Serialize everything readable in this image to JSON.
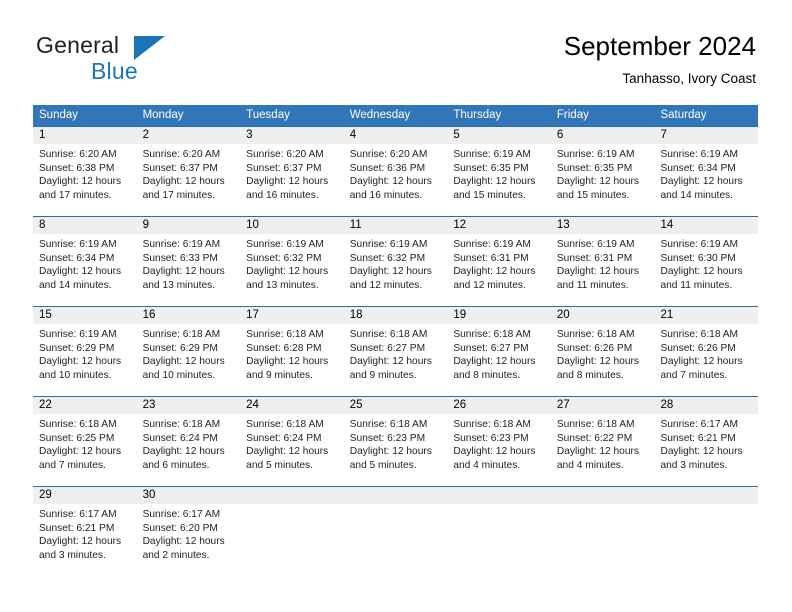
{
  "brand": {
    "name_part1": "General",
    "name_part2": "Blue",
    "logo_icon": "triangle-icon"
  },
  "header": {
    "title": "September 2024",
    "location": "Tanhasso, Ivory Coast"
  },
  "colors": {
    "header_blue": "#3176b9",
    "separator_blue": "#2b6cab",
    "date_band_gray": "#efefef",
    "brand_blue": "#1b75bb",
    "text": "#231f20"
  },
  "weekdays": [
    "Sunday",
    "Monday",
    "Tuesday",
    "Wednesday",
    "Thursday",
    "Friday",
    "Saturday"
  ],
  "weeks": [
    {
      "days": [
        {
          "date": "1",
          "sunrise": "Sunrise: 6:20 AM",
          "sunset": "Sunset: 6:38 PM",
          "daylight1": "Daylight: 12 hours",
          "daylight2": "and 17 minutes."
        },
        {
          "date": "2",
          "sunrise": "Sunrise: 6:20 AM",
          "sunset": "Sunset: 6:37 PM",
          "daylight1": "Daylight: 12 hours",
          "daylight2": "and 17 minutes."
        },
        {
          "date": "3",
          "sunrise": "Sunrise: 6:20 AM",
          "sunset": "Sunset: 6:37 PM",
          "daylight1": "Daylight: 12 hours",
          "daylight2": "and 16 minutes."
        },
        {
          "date": "4",
          "sunrise": "Sunrise: 6:20 AM",
          "sunset": "Sunset: 6:36 PM",
          "daylight1": "Daylight: 12 hours",
          "daylight2": "and 16 minutes."
        },
        {
          "date": "5",
          "sunrise": "Sunrise: 6:19 AM",
          "sunset": "Sunset: 6:35 PM",
          "daylight1": "Daylight: 12 hours",
          "daylight2": "and 15 minutes."
        },
        {
          "date": "6",
          "sunrise": "Sunrise: 6:19 AM",
          "sunset": "Sunset: 6:35 PM",
          "daylight1": "Daylight: 12 hours",
          "daylight2": "and 15 minutes."
        },
        {
          "date": "7",
          "sunrise": "Sunrise: 6:19 AM",
          "sunset": "Sunset: 6:34 PM",
          "daylight1": "Daylight: 12 hours",
          "daylight2": "and 14 minutes."
        }
      ]
    },
    {
      "days": [
        {
          "date": "8",
          "sunrise": "Sunrise: 6:19 AM",
          "sunset": "Sunset: 6:34 PM",
          "daylight1": "Daylight: 12 hours",
          "daylight2": "and 14 minutes."
        },
        {
          "date": "9",
          "sunrise": "Sunrise: 6:19 AM",
          "sunset": "Sunset: 6:33 PM",
          "daylight1": "Daylight: 12 hours",
          "daylight2": "and 13 minutes."
        },
        {
          "date": "10",
          "sunrise": "Sunrise: 6:19 AM",
          "sunset": "Sunset: 6:32 PM",
          "daylight1": "Daylight: 12 hours",
          "daylight2": "and 13 minutes."
        },
        {
          "date": "11",
          "sunrise": "Sunrise: 6:19 AM",
          "sunset": "Sunset: 6:32 PM",
          "daylight1": "Daylight: 12 hours",
          "daylight2": "and 12 minutes."
        },
        {
          "date": "12",
          "sunrise": "Sunrise: 6:19 AM",
          "sunset": "Sunset: 6:31 PM",
          "daylight1": "Daylight: 12 hours",
          "daylight2": "and 12 minutes."
        },
        {
          "date": "13",
          "sunrise": "Sunrise: 6:19 AM",
          "sunset": "Sunset: 6:31 PM",
          "daylight1": "Daylight: 12 hours",
          "daylight2": "and 11 minutes."
        },
        {
          "date": "14",
          "sunrise": "Sunrise: 6:19 AM",
          "sunset": "Sunset: 6:30 PM",
          "daylight1": "Daylight: 12 hours",
          "daylight2": "and 11 minutes."
        }
      ]
    },
    {
      "days": [
        {
          "date": "15",
          "sunrise": "Sunrise: 6:19 AM",
          "sunset": "Sunset: 6:29 PM",
          "daylight1": "Daylight: 12 hours",
          "daylight2": "and 10 minutes."
        },
        {
          "date": "16",
          "sunrise": "Sunrise: 6:18 AM",
          "sunset": "Sunset: 6:29 PM",
          "daylight1": "Daylight: 12 hours",
          "daylight2": "and 10 minutes."
        },
        {
          "date": "17",
          "sunrise": "Sunrise: 6:18 AM",
          "sunset": "Sunset: 6:28 PM",
          "daylight1": "Daylight: 12 hours",
          "daylight2": "and 9 minutes."
        },
        {
          "date": "18",
          "sunrise": "Sunrise: 6:18 AM",
          "sunset": "Sunset: 6:27 PM",
          "daylight1": "Daylight: 12 hours",
          "daylight2": "and 9 minutes."
        },
        {
          "date": "19",
          "sunrise": "Sunrise: 6:18 AM",
          "sunset": "Sunset: 6:27 PM",
          "daylight1": "Daylight: 12 hours",
          "daylight2": "and 8 minutes."
        },
        {
          "date": "20",
          "sunrise": "Sunrise: 6:18 AM",
          "sunset": "Sunset: 6:26 PM",
          "daylight1": "Daylight: 12 hours",
          "daylight2": "and 8 minutes."
        },
        {
          "date": "21",
          "sunrise": "Sunrise: 6:18 AM",
          "sunset": "Sunset: 6:26 PM",
          "daylight1": "Daylight: 12 hours",
          "daylight2": "and 7 minutes."
        }
      ]
    },
    {
      "days": [
        {
          "date": "22",
          "sunrise": "Sunrise: 6:18 AM",
          "sunset": "Sunset: 6:25 PM",
          "daylight1": "Daylight: 12 hours",
          "daylight2": "and 7 minutes."
        },
        {
          "date": "23",
          "sunrise": "Sunrise: 6:18 AM",
          "sunset": "Sunset: 6:24 PM",
          "daylight1": "Daylight: 12 hours",
          "daylight2": "and 6 minutes."
        },
        {
          "date": "24",
          "sunrise": "Sunrise: 6:18 AM",
          "sunset": "Sunset: 6:24 PM",
          "daylight1": "Daylight: 12 hours",
          "daylight2": "and 5 minutes."
        },
        {
          "date": "25",
          "sunrise": "Sunrise: 6:18 AM",
          "sunset": "Sunset: 6:23 PM",
          "daylight1": "Daylight: 12 hours",
          "daylight2": "and 5 minutes."
        },
        {
          "date": "26",
          "sunrise": "Sunrise: 6:18 AM",
          "sunset": "Sunset: 6:23 PM",
          "daylight1": "Daylight: 12 hours",
          "daylight2": "and 4 minutes."
        },
        {
          "date": "27",
          "sunrise": "Sunrise: 6:18 AM",
          "sunset": "Sunset: 6:22 PM",
          "daylight1": "Daylight: 12 hours",
          "daylight2": "and 4 minutes."
        },
        {
          "date": "28",
          "sunrise": "Sunrise: 6:17 AM",
          "sunset": "Sunset: 6:21 PM",
          "daylight1": "Daylight: 12 hours",
          "daylight2": "and 3 minutes."
        }
      ]
    },
    {
      "days": [
        {
          "date": "29",
          "sunrise": "Sunrise: 6:17 AM",
          "sunset": "Sunset: 6:21 PM",
          "daylight1": "Daylight: 12 hours",
          "daylight2": "and 3 minutes."
        },
        {
          "date": "30",
          "sunrise": "Sunrise: 6:17 AM",
          "sunset": "Sunset: 6:20 PM",
          "daylight1": "Daylight: 12 hours",
          "daylight2": "and 2 minutes."
        },
        {
          "date": "",
          "sunrise": "",
          "sunset": "",
          "daylight1": "",
          "daylight2": ""
        },
        {
          "date": "",
          "sunrise": "",
          "sunset": "",
          "daylight1": "",
          "daylight2": ""
        },
        {
          "date": "",
          "sunrise": "",
          "sunset": "",
          "daylight1": "",
          "daylight2": ""
        },
        {
          "date": "",
          "sunrise": "",
          "sunset": "",
          "daylight1": "",
          "daylight2": ""
        },
        {
          "date": "",
          "sunrise": "",
          "sunset": "",
          "daylight1": "",
          "daylight2": ""
        }
      ]
    }
  ]
}
